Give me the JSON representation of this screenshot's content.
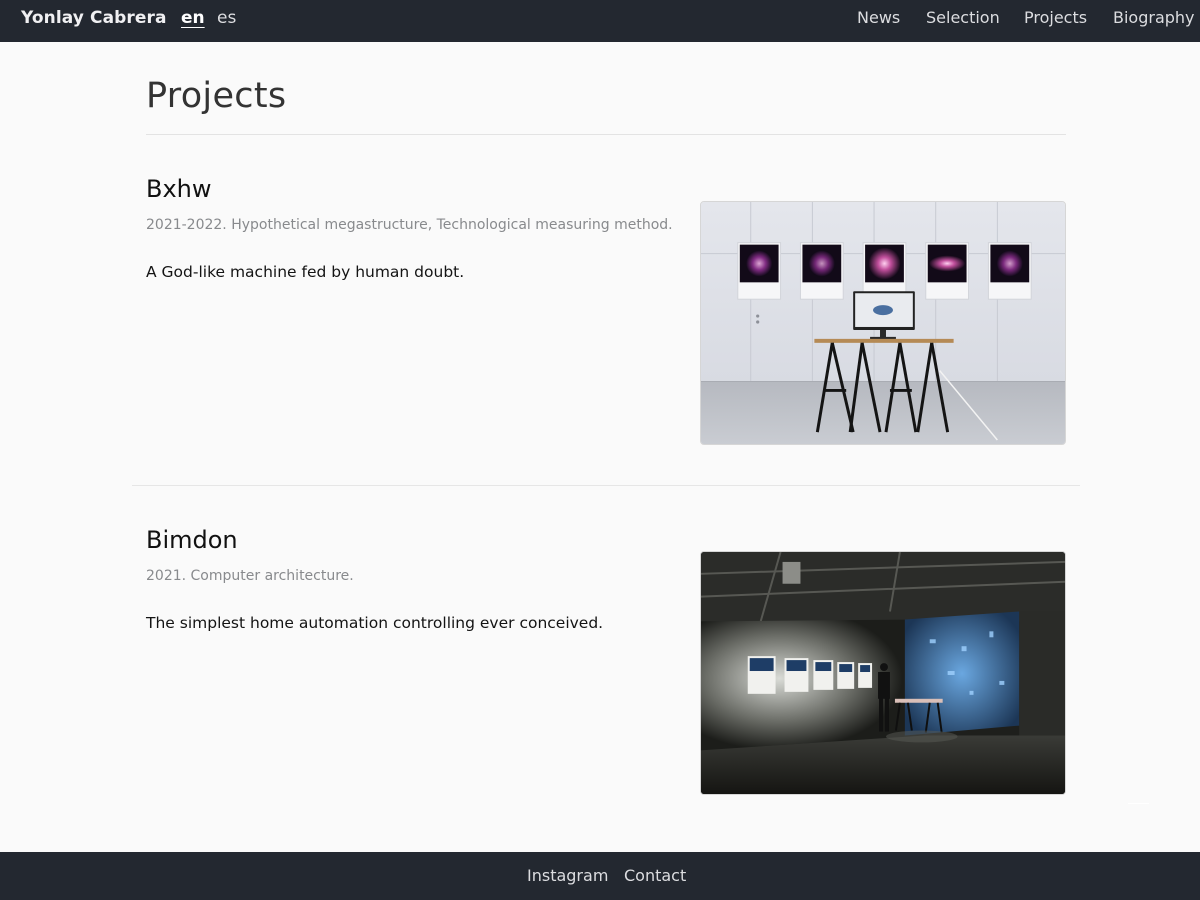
{
  "header": {
    "brand": "Yonlay Cabrera",
    "languages": [
      {
        "label": "en",
        "active": true
      },
      {
        "label": "es",
        "active": false
      }
    ],
    "nav": [
      "News",
      "Selection",
      "Projects",
      "Biography"
    ]
  },
  "page": {
    "title": "Projects"
  },
  "projects": [
    {
      "title": "Bxhw",
      "meta": "2021-2022. Hypothetical megastructure, Technological measuring method.",
      "description": "A God-like machine fed by human doubt."
    },
    {
      "title": "Bimdon",
      "meta": "2021. Computer architecture.",
      "description": "The simplest home automation controlling ever conceived."
    }
  ],
  "footer": {
    "links": [
      "Instagram",
      "Contact"
    ]
  },
  "colors": {
    "navbar": "#232830",
    "page_background": "#fafafa",
    "meta_text": "#888a8d"
  }
}
